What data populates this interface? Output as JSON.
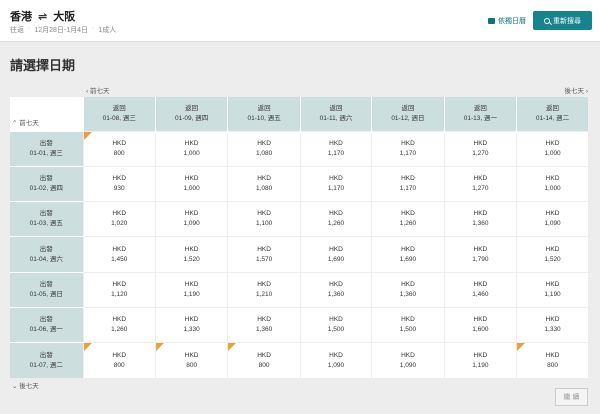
{
  "header": {
    "origin": "香港",
    "swap_icon": "⇌",
    "destination": "大阪",
    "trip_type": "往返",
    "dates": "12月28日-1月4日",
    "passengers": "1成人",
    "calendar_link": "依獨日曆",
    "search_button": "重新搜尋"
  },
  "page_title": "請選擇日期",
  "nav": {
    "prev_week": "‹ 前七天",
    "next_week": "後七天 ›",
    "earlier": "⌃ 前七天",
    "later": "⌄ 後七天"
  },
  "columns": [
    {
      "label": "返回",
      "date": "01-08, 週三"
    },
    {
      "label": "返回",
      "date": "01-09, 週四"
    },
    {
      "label": "返回",
      "date": "01-10, 週五"
    },
    {
      "label": "返回",
      "date": "01-11, 週六"
    },
    {
      "label": "返回",
      "date": "01-12, 週日"
    },
    {
      "label": "返回",
      "date": "01-13, 週一"
    },
    {
      "label": "返回",
      "date": "01-14, 週二"
    }
  ],
  "rows": [
    {
      "label": "出發",
      "date": "01-01, 週三",
      "prices": [
        "800",
        "1,000",
        "1,080",
        "1,170",
        "1,170",
        "1,270",
        "1,000"
      ],
      "flags": [
        0
      ]
    },
    {
      "label": "出發",
      "date": "01-02, 週四",
      "prices": [
        "930",
        "1,000",
        "1,080",
        "1,170",
        "1,170",
        "1,270",
        "1,000"
      ],
      "flags": []
    },
    {
      "label": "出發",
      "date": "01-03, 週五",
      "prices": [
        "1,020",
        "1,090",
        "1,100",
        "1,260",
        "1,260",
        "1,360",
        "1,090"
      ],
      "flags": []
    },
    {
      "label": "出發",
      "date": "01-04, 週六",
      "prices": [
        "1,450",
        "1,520",
        "1,570",
        "1,690",
        "1,690",
        "1,790",
        "1,520"
      ],
      "flags": []
    },
    {
      "label": "出發",
      "date": "01-05, 週日",
      "prices": [
        "1,120",
        "1,190",
        "1,210",
        "1,360",
        "1,360",
        "1,460",
        "1,190"
      ],
      "flags": []
    },
    {
      "label": "出發",
      "date": "01-06, 週一",
      "prices": [
        "1,260",
        "1,330",
        "1,360",
        "1,500",
        "1,500",
        "1,600",
        "1,330"
      ],
      "flags": []
    },
    {
      "label": "出發",
      "date": "01-07, 週二",
      "prices": [
        "800",
        "800",
        "800",
        "1,090",
        "1,090",
        "1,190",
        "800"
      ],
      "flags": [
        0,
        1,
        2,
        6
      ]
    }
  ],
  "currency": "HKD",
  "continue_button": "繼 續",
  "colors": {
    "accent": "#15848c",
    "header_cell": "#cddedf",
    "flag": "#e8a23a"
  }
}
